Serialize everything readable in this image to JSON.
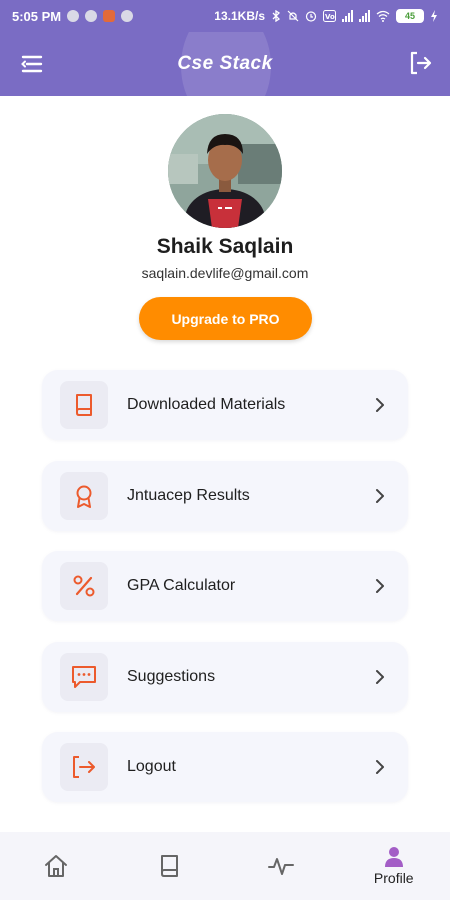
{
  "status_bar": {
    "time": "5:05 PM",
    "network_speed": "13.1KB/s",
    "battery": "45"
  },
  "app_bar": {
    "title": "Cse Stack",
    "menu_icon": "menu-icon",
    "logout_icon": "exit-icon"
  },
  "profile": {
    "name": "Shaik Saqlain",
    "email": "saqlain.devlife@gmail.com",
    "upgrade_label": "Upgrade to PRO"
  },
  "menu": {
    "items": [
      {
        "label": "Downloaded Materials",
        "icon": "book-icon"
      },
      {
        "label": "Jntuacep Results",
        "icon": "award-icon"
      },
      {
        "label": "GPA Calculator",
        "icon": "percent-icon"
      },
      {
        "label": "Suggestions",
        "icon": "message-icon"
      },
      {
        "label": "Logout",
        "icon": "logout-icon"
      }
    ]
  },
  "bottom_nav": {
    "items": [
      {
        "icon": "home-icon",
        "label": ""
      },
      {
        "icon": "book-icon",
        "label": ""
      },
      {
        "icon": "activity-icon",
        "label": ""
      },
      {
        "icon": "person-icon",
        "label": "Profile",
        "active": true
      }
    ]
  },
  "colors": {
    "primary": "#7a6cc4",
    "accent": "#ff8c00",
    "icon": "#ec5a2c",
    "nav_active": "#a35dc6",
    "nav_inactive": "#666666"
  }
}
